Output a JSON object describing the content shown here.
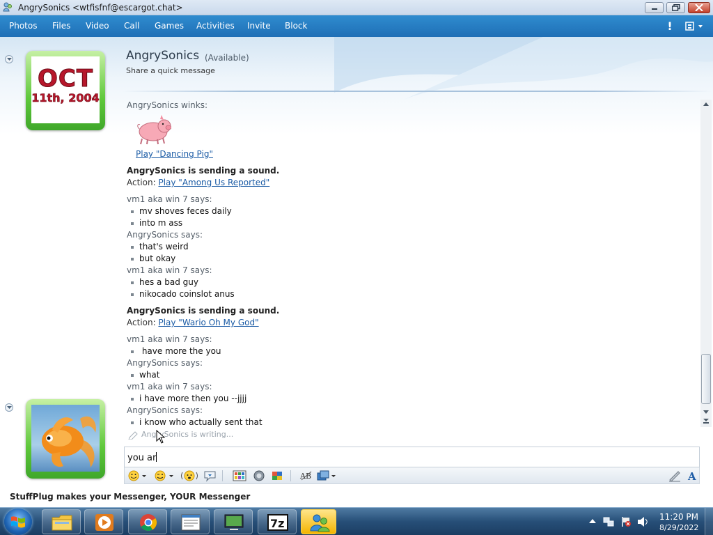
{
  "window": {
    "title": "AngrySonics <wtfisfnf@escargot.chat>",
    "icon": "messenger-buddy-icon"
  },
  "menu": [
    "Photos",
    "Files",
    "Video",
    "Call",
    "Games",
    "Activities",
    "Invite",
    "Block"
  ],
  "contact": {
    "name": "AngrySonics",
    "status": "(Available)",
    "personal_message": "Share a quick message",
    "avatar_text_line1": "OCT",
    "avatar_text_line2": "11th, 2004"
  },
  "conversation": {
    "wink_header": "AngrySonics winks:",
    "wink_link": "Play \"Dancing Pig\"",
    "sound1_header": "AngrySonics is sending a sound.",
    "sound1_action_label": "Action:",
    "sound1_link": "Play \"Among Us Reported\"",
    "sender_vm1": "vm1 aka win 7 says:",
    "sender_angry": "AngrySonics says:",
    "m1": "mv shoves feces daily",
    "m2": "into m ass",
    "m3": "that's weird",
    "m4": "but okay",
    "m5": "hes a bad guy",
    "m6": "nikocado coinslot anus",
    "sound2_header": "AngrySonics is sending a sound.",
    "sound2_action_label": "Action:",
    "sound2_link": "Play \"Wario Oh My God\"",
    "m7": " have more the you",
    "m8": "what",
    "m9": "i have more then you --jjjj",
    "m10": "i know who actually sent that",
    "typing_status": "AngrySonics is writing..."
  },
  "input": {
    "value": "you ar"
  },
  "ad": {
    "text": "StuffPlug makes your Messenger, YOUR Messenger"
  },
  "taskbar": {
    "time": "11:20 PM",
    "date": "8/29/2022",
    "apps": [
      "explorer-icon",
      "media-player-icon",
      "chrome-icon",
      "notepad-icon",
      "remote-desktop-icon",
      "7zip-icon",
      "messenger-icon"
    ],
    "sevenzip_label": "7z"
  },
  "colors": {
    "menubar": "#2276be",
    "link": "#1b5ba5",
    "avatar_frame": "#5fc83b",
    "taskbar": "#274f78"
  }
}
